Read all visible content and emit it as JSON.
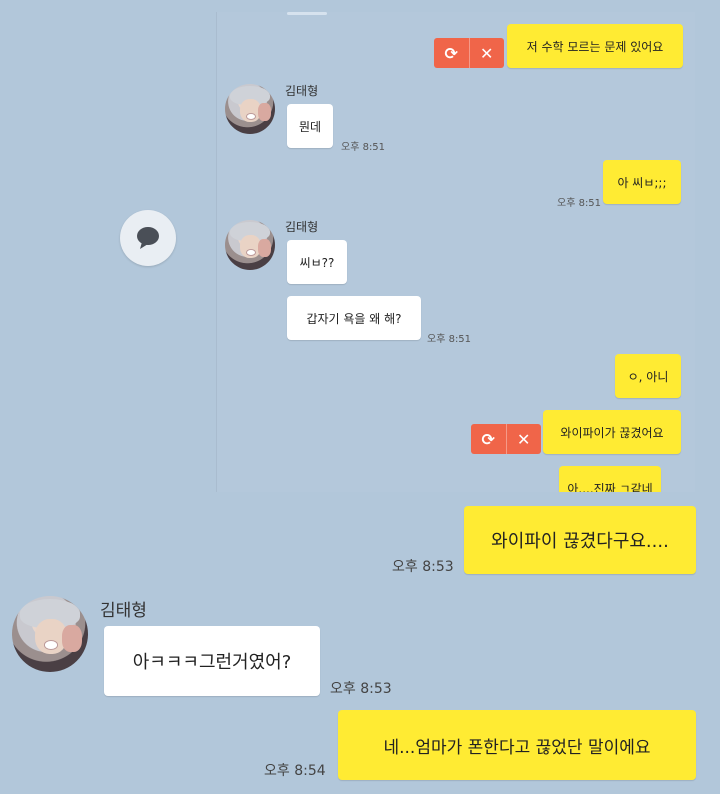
{
  "inner_screenshot": {
    "messages": [
      {
        "id": "m1",
        "side": "me",
        "text": "저 수학 모르는 문제 있어요",
        "status": "failed"
      },
      {
        "id": "m2",
        "side": "them",
        "name": "김태형",
        "text": "뭔데",
        "time": "오후 8:51"
      },
      {
        "id": "m3",
        "side": "me",
        "text": "아 씨ㅂ;;;",
        "time": "오후 8:51"
      },
      {
        "id": "m4",
        "side": "them",
        "name": "김태형",
        "text": "씨ㅂ??"
      },
      {
        "id": "m5",
        "side": "them",
        "text": "갑자기 욕을 왜 해?",
        "time": "오후 8:51"
      },
      {
        "id": "m6",
        "side": "me",
        "text": "ㅇ, 아니"
      },
      {
        "id": "m7",
        "side": "me",
        "text": "와이파이가 끊겼어요",
        "status": "failed"
      },
      {
        "id": "m8",
        "side": "me",
        "text": "아....진짜 ㄱ같네"
      }
    ],
    "fail_actions": {
      "retry_icon": "retry-icon",
      "cancel_icon": "close-icon"
    }
  },
  "chat_button_icon": "speech-bubble-icon",
  "outer_messages": [
    {
      "id": "o1",
      "side": "me",
      "text": "와이파이 끊겼다구요....",
      "time": "오후 8:53"
    },
    {
      "id": "o2",
      "side": "them",
      "name": "김태형",
      "text": "아ㅋㅋㅋ그런거였어?",
      "time": "오후 8:53"
    },
    {
      "id": "o3",
      "side": "me",
      "text": "네...엄마가 폰한다고 끊었단 말이에요",
      "time": "오후 8:54"
    }
  ],
  "colors": {
    "background": "#b2c7da",
    "my_bubble": "#ffeb33",
    "their_bubble": "#ffffff",
    "fail": "#f06549"
  }
}
